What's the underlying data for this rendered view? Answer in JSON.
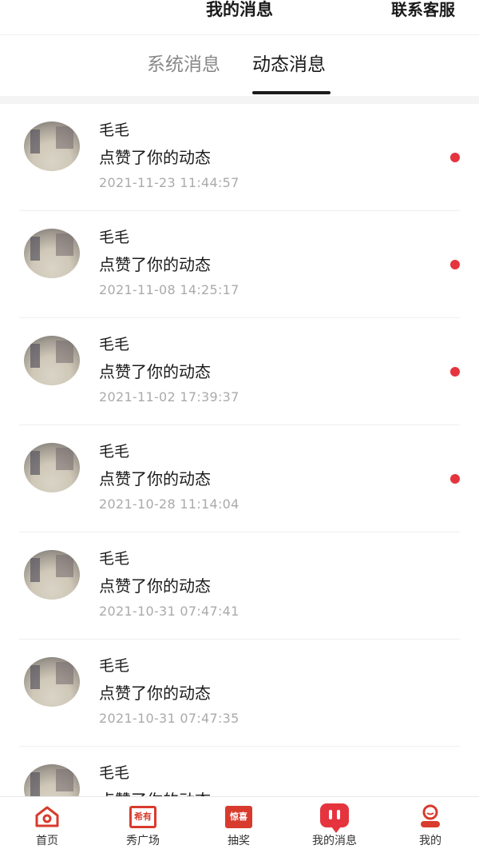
{
  "header": {
    "title": "我的消息",
    "service_label": "联系客服"
  },
  "tabs": [
    {
      "label": "系统消息",
      "active": false
    },
    {
      "label": "动态消息",
      "active": true
    }
  ],
  "messages": [
    {
      "name": "毛毛",
      "action": "点赞了你的动态",
      "time": "2021-11-23 11:44:57",
      "unread": true
    },
    {
      "name": "毛毛",
      "action": "点赞了你的动态",
      "time": "2021-11-08 14:25:17",
      "unread": true
    },
    {
      "name": "毛毛",
      "action": "点赞了你的动态",
      "time": "2021-11-02 17:39:37",
      "unread": true
    },
    {
      "name": "毛毛",
      "action": "点赞了你的动态",
      "time": "2021-10-28 11:14:04",
      "unread": true
    },
    {
      "name": "毛毛",
      "action": "点赞了你的动态",
      "time": "2021-10-31 07:47:41",
      "unread": false
    },
    {
      "name": "毛毛",
      "action": "点赞了你的动态",
      "time": "2021-10-31 07:47:35",
      "unread": false
    },
    {
      "name": "毛毛",
      "action": "点赞了你的动态",
      "time": "",
      "unread": false
    }
  ],
  "tabbar": {
    "home": {
      "label": "首页",
      "icon": "home-icon"
    },
    "show": {
      "label": "秀广场",
      "icon": "show-square-icon",
      "icon_text": "希有"
    },
    "lottery": {
      "label": "抽奖",
      "icon": "lottery-icon",
      "icon_text": "惊喜"
    },
    "messages": {
      "label": "我的消息",
      "icon": "message-icon"
    },
    "me": {
      "label": "我的",
      "icon": "profile-icon"
    }
  },
  "colors": {
    "accent": "#e5343e",
    "icon_red": "#d83b2d",
    "timestamp": "#aaaaaa"
  }
}
